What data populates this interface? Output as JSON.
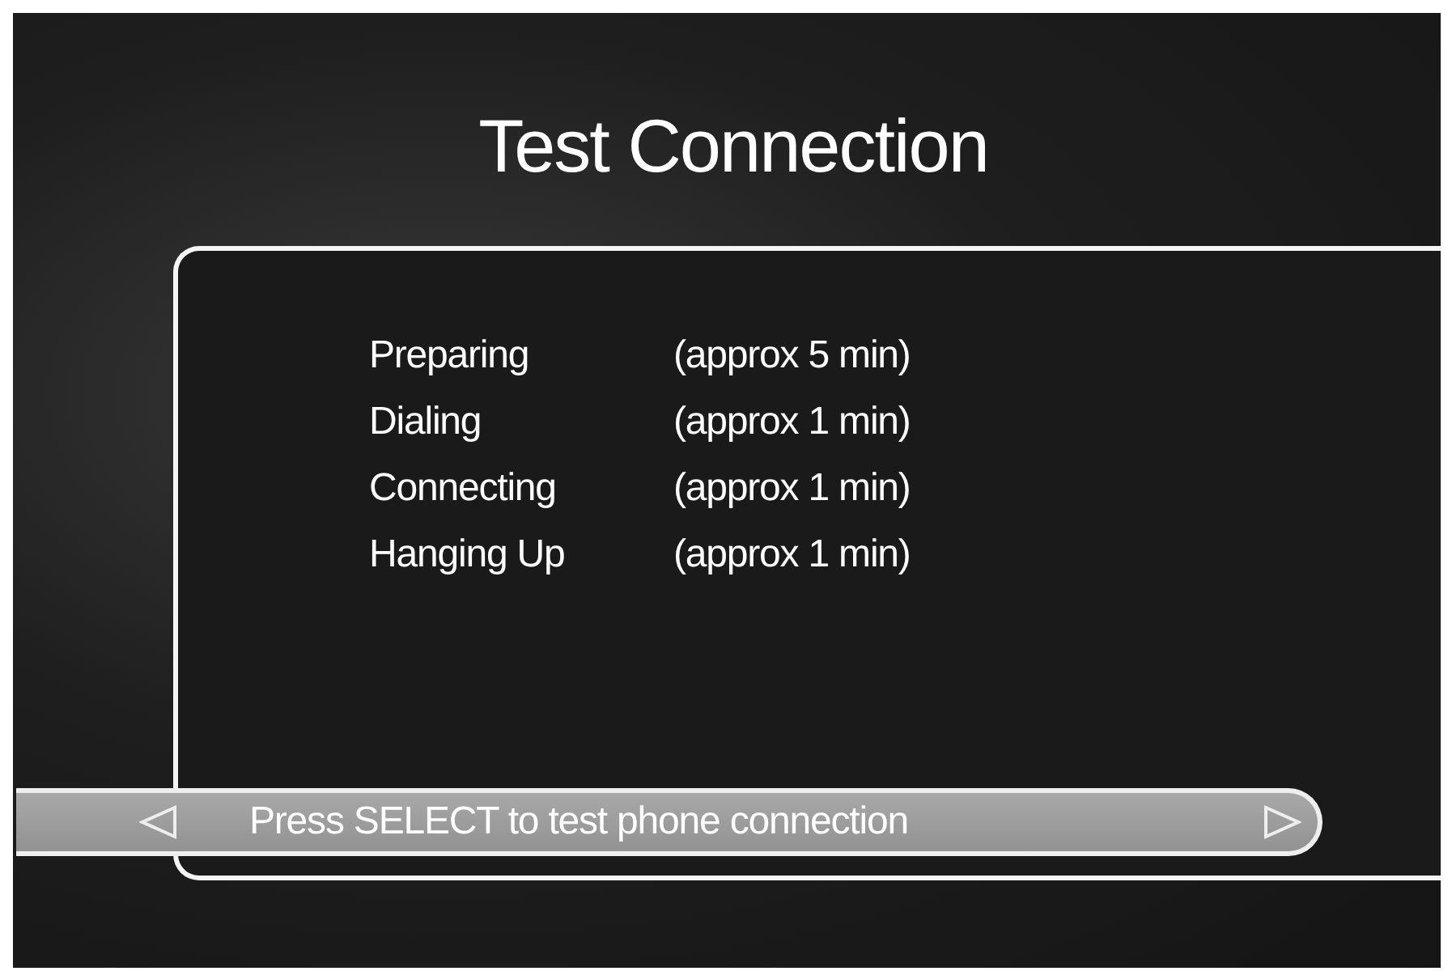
{
  "title": "Test Connection",
  "steps": [
    {
      "name": "Preparing",
      "duration": "(approx 5 min)"
    },
    {
      "name": "Dialing",
      "duration": "(approx 1 min)"
    },
    {
      "name": "Connecting",
      "duration": "(approx 1 min)"
    },
    {
      "name": "Hanging Up",
      "duration": "(approx 1 min)"
    }
  ],
  "prompt_bar": {
    "text": "Press SELECT to test phone connection"
  }
}
